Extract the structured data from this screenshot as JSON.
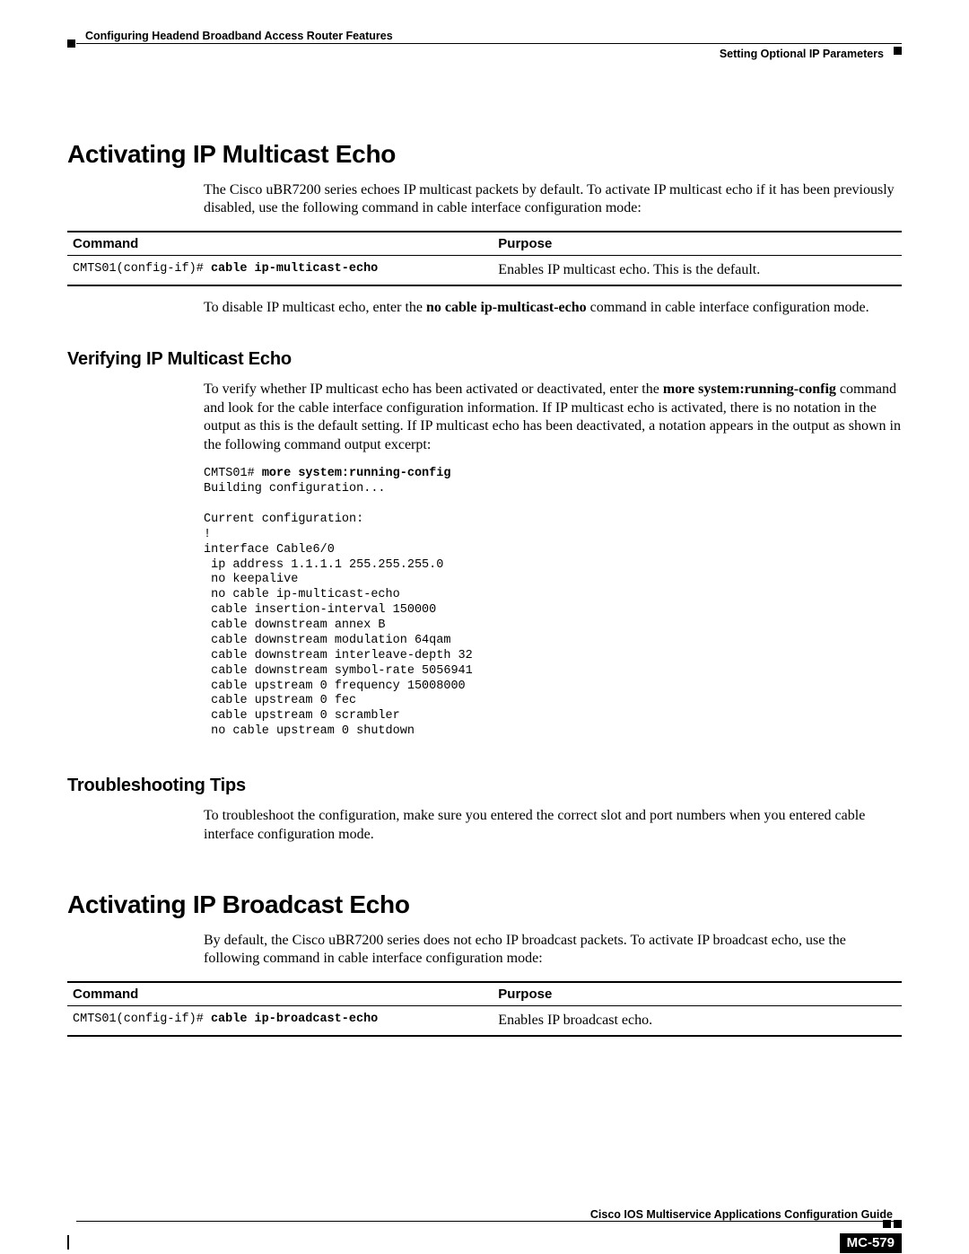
{
  "header": {
    "chapter": "Configuring Headend Broadband Access Router Features",
    "section": "Setting Optional IP Parameters"
  },
  "s1": {
    "title": "Activating IP Multicast Echo",
    "intro": "The Cisco uBR7200 series echoes IP multicast packets by default. To activate IP multicast echo if it has been previously disabled, use the following command in cable interface configuration mode:",
    "table": {
      "h1": "Command",
      "h2": "Purpose",
      "prompt": "CMTS01(config-if)# ",
      "cmd": "cable ip-multicast-echo",
      "purpose": "Enables IP multicast echo. This is the default."
    },
    "disable_pre": "To disable IP multicast echo, enter the ",
    "disable_cmd": "no cable ip-multicast-echo",
    "disable_post": " command in cable interface configuration mode."
  },
  "s2": {
    "title": "Verifying IP Multicast Echo",
    "p_pre": "To verify whether IP multicast echo has been activated or deactivated, enter the ",
    "p_bold": "more system:running-config",
    "p_post": " command and look for the cable interface configuration information. If IP multicast echo is activated, there is no notation in the output as this is the default setting. If IP multicast echo has been deactivated, a notation appears in the output as shown in the following command output excerpt:",
    "code_prompt": "CMTS01# ",
    "code_cmd": "more system:running-config",
    "code_body": "Building configuration...\n\nCurrent configuration:\n!\ninterface Cable6/0\n ip address 1.1.1.1 255.255.255.0\n no keepalive\n no cable ip-multicast-echo\n cable insertion-interval 150000\n cable downstream annex B\n cable downstream modulation 64qam\n cable downstream interleave-depth 32\n cable downstream symbol-rate 5056941\n cable upstream 0 frequency 15008000\n cable upstream 0 fec\n cable upstream 0 scrambler\n no cable upstream 0 shutdown"
  },
  "s3": {
    "title": "Troubleshooting Tips",
    "p": "To troubleshoot the configuration, make sure you entered the correct slot and port numbers when you entered cable interface configuration mode."
  },
  "s4": {
    "title": "Activating IP Broadcast Echo",
    "intro": "By default, the Cisco uBR7200 series does not echo IP broadcast packets. To activate IP broadcast echo, use the following command in cable interface configuration mode:",
    "table": {
      "h1": "Command",
      "h2": "Purpose",
      "prompt": "CMTS01(config-if)# ",
      "cmd": "cable ip-broadcast-echo",
      "purpose": "Enables IP broadcast echo."
    }
  },
  "footer": {
    "guide": "Cisco IOS Multiservice Applications Configuration Guide",
    "page": "MC-579"
  }
}
